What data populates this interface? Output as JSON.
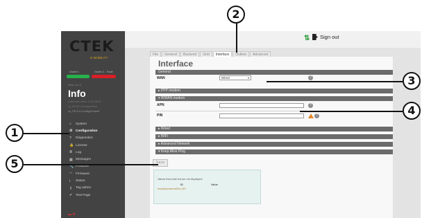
{
  "brand": {
    "logo": "CTEK",
    "tagline": "E-MOBILITY",
    "slot1_label": "Outlet 1",
    "slot2_label": "Outlet 2 - Fault",
    "version": "Vers. 4.1.1",
    "colors": {
      "slot1": "#27b14a",
      "slot2": "#d81f26",
      "accent": "#d9a11d"
    }
  },
  "sidebar": {
    "title": "Info",
    "info_lines": [
      "Unknown ident: 1234 5678",
      "cs_EVSE-Configuration",
      "cs_PR 5.6-Config/Default"
    ],
    "items": [
      {
        "icon": "home-icon",
        "glyph": "⌂",
        "label": "System"
      },
      {
        "icon": "gear-icon",
        "glyph": "⚙",
        "label": "Configuration",
        "active": true
      },
      {
        "icon": "question-icon",
        "glyph": "?",
        "label": "Diagnostics"
      },
      {
        "icon": "lock-icon",
        "glyph": "🔒",
        "label": "License"
      },
      {
        "icon": "list-icon",
        "glyph": "≣",
        "label": "Log"
      },
      {
        "icon": "chart-icon",
        "glyph": "▦",
        "label": "Messages"
      },
      {
        "icon": "wrench-icon",
        "glyph": "🔧",
        "label": "Products"
      },
      {
        "icon": "wifi-icon",
        "glyph": "◠",
        "label": "Firmware"
      },
      {
        "icon": "info-icon",
        "glyph": "i",
        "label": "Status"
      },
      {
        "icon": "key-icon",
        "glyph": "⚷",
        "label": "Tag admin"
      },
      {
        "icon": "check-icon",
        "glyph": "✔",
        "label": "Test Page"
      }
    ]
  },
  "topbar": {
    "sort_glyph": "⇅",
    "signout_label": "Sign out"
  },
  "tabs": [
    {
      "label": "File"
    },
    {
      "label": "General"
    },
    {
      "label": "Backend"
    },
    {
      "label": "Grid"
    },
    {
      "label": "Interface",
      "active": true
    },
    {
      "label": "Outlets"
    },
    {
      "label": "Advanced"
    }
  ],
  "page": {
    "title": "Interface",
    "general_header": "General",
    "wan_label": "WAN",
    "wan_value": "Wired",
    "ppp_header": "▸ PPP modem",
    "wwan_header": "▾ WWAN modem",
    "apn_label": "APN",
    "apn_value": "",
    "pin_label": "PIN",
    "pin_value": "",
    "collapsed_sections": [
      "▸ Wired",
      "▸ WiFi",
      "▸ Advanced Network",
      "▾ Keep Alive Ping"
    ],
    "save_label": "Save",
    "help_glyph": "?"
  },
  "notice": {
    "text": "Values that exist but are not displayed:",
    "col_id": "ID",
    "col_value": "Value",
    "row": "keepAliveIntervalSec      240"
  },
  "callouts": [
    "1",
    "2",
    "3",
    "4",
    "5"
  ]
}
